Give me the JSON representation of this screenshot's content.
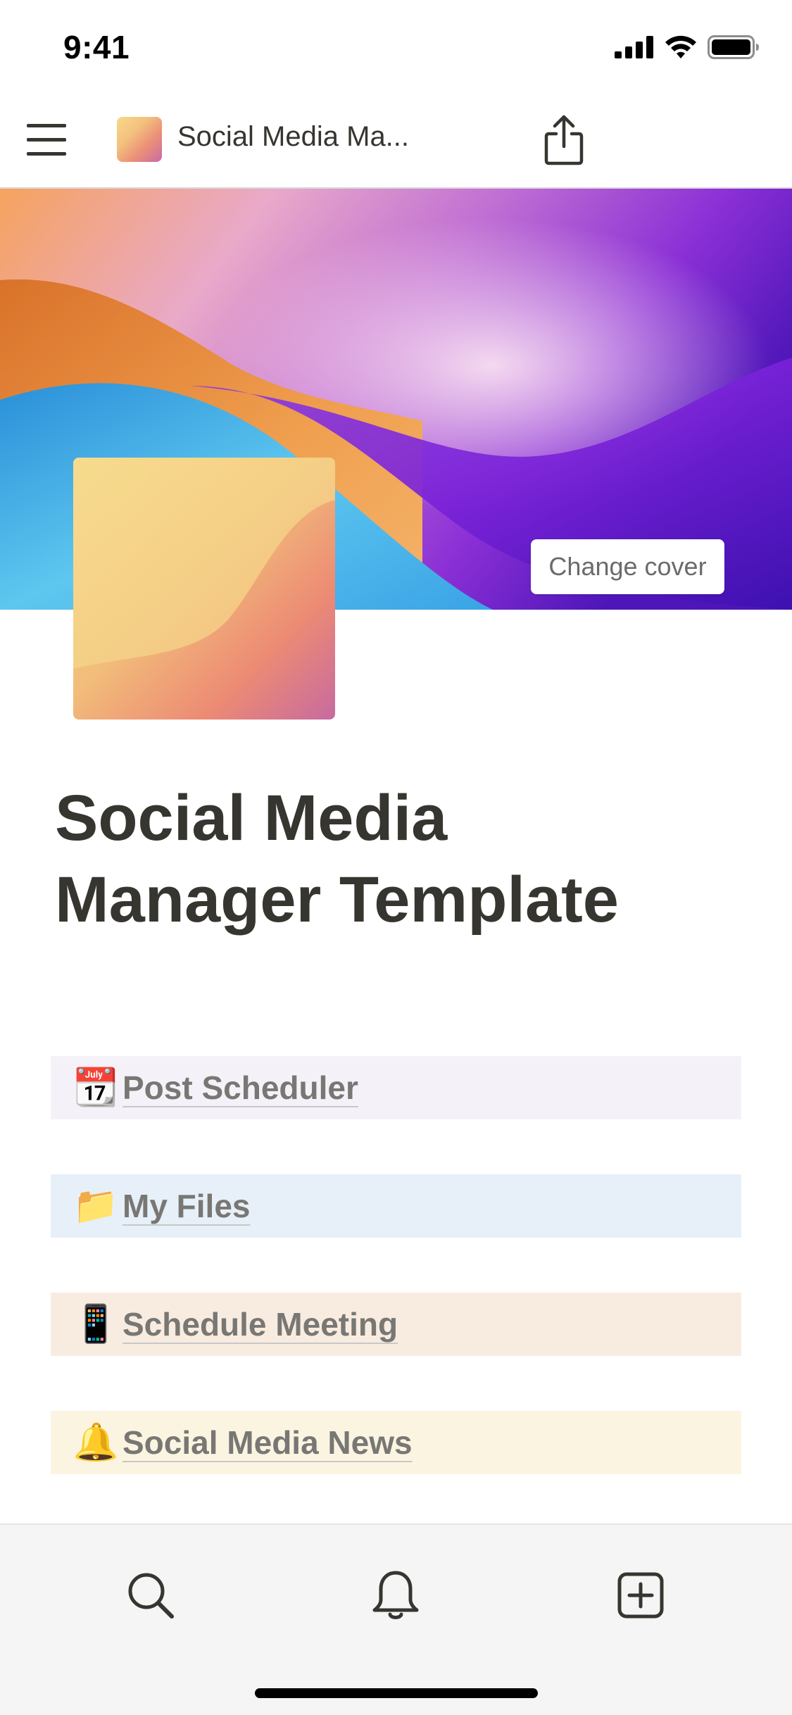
{
  "status_bar": {
    "time": "9:41"
  },
  "nav": {
    "title": "Social Media Ma..."
  },
  "cover": {
    "change_cover_label": "Change cover"
  },
  "page": {
    "title_line1": "Social Media",
    "title_line2": "Manager Template"
  },
  "links": [
    {
      "emoji": "📆",
      "label": "Post Scheduler"
    },
    {
      "emoji": "📁",
      "label": "My Files"
    },
    {
      "emoji": "📱",
      "label": "Schedule Meeting"
    },
    {
      "emoji": "🔔",
      "label": "Social Media News"
    }
  ],
  "tabs": [
    {
      "icon": "search-icon"
    },
    {
      "icon": "bell-icon"
    },
    {
      "icon": "new-page-icon"
    }
  ],
  "colors": {
    "text": "#37352f",
    "link_text": "#787774",
    "block_purple": "#f4f2f8",
    "block_blue": "#e7f0f8",
    "block_orange": "#f8ece1",
    "block_yellow": "#fbf4e1"
  }
}
